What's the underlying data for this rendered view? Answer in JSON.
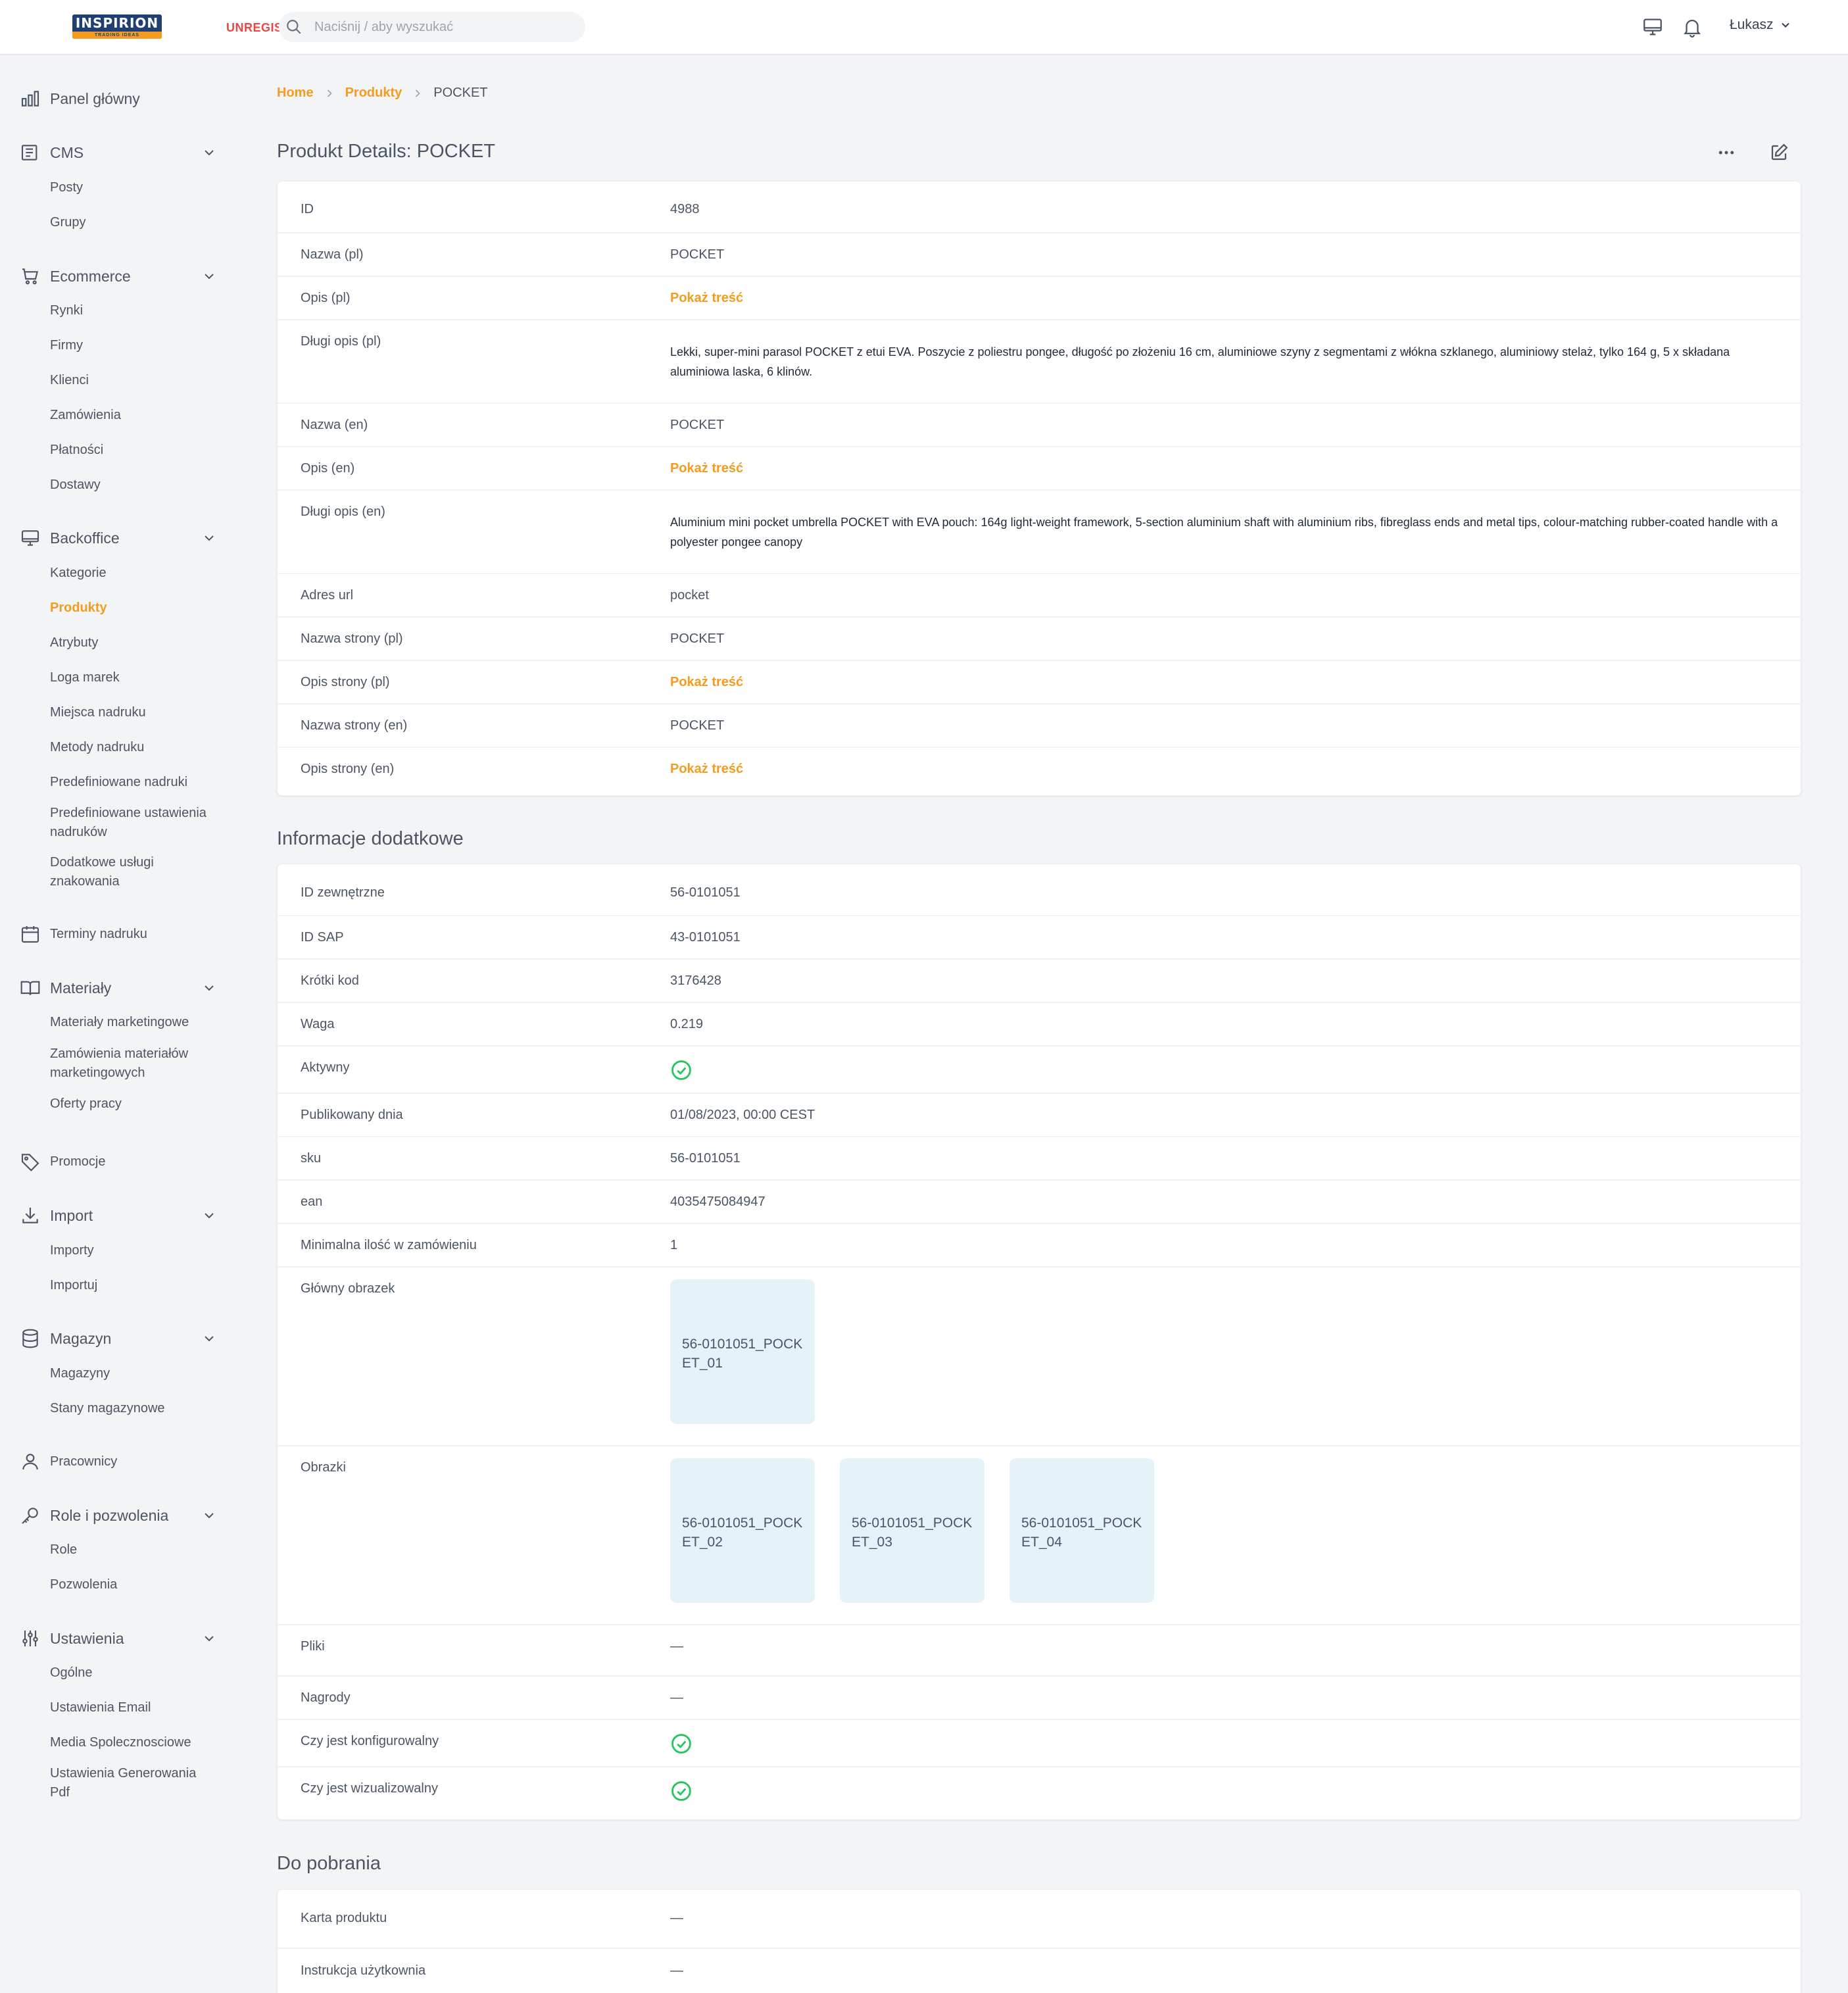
{
  "header": {
    "logo": "INSPIRION",
    "logo_tag": "TRADING IDEAS",
    "unregistered": "UNREGIS",
    "search_placeholder": "Naciśnij / aby wyszukać",
    "user": "Łukasz"
  },
  "sidebar": {
    "groups": [
      {
        "label": "Panel główny",
        "icon": "chart-bar-icon",
        "items": []
      },
      {
        "label": "CMS",
        "icon": "newspaper-icon",
        "items": [
          "Posty",
          "Grupy"
        ]
      },
      {
        "label": "Ecommerce",
        "icon": "cart-icon",
        "items": [
          "Rynki",
          "Firmy",
          "Klienci",
          "Zamówienia",
          "Płatności",
          "Dostawy"
        ]
      },
      {
        "label": "Backoffice",
        "icon": "monitor-icon",
        "items": [
          "Kategorie",
          "Produkty",
          "Atrybuty",
          "Loga marek",
          "Miejsca nadruku",
          "Metody nadruku",
          "Predefiniowane nadruki",
          "Predefiniowane ustawienia nadruków",
          "Dodatkowe usługi znakowania"
        ]
      },
      {
        "label": "Terminy nadruku",
        "icon": "calendar-icon",
        "items": []
      },
      {
        "label": "Materiały",
        "icon": "book-icon",
        "items": [
          "Materiały marketingowe",
          "Zamówienia materiałów marketingowych",
          "Oferty pracy"
        ]
      },
      {
        "label": "Promocje",
        "icon": "tag-icon",
        "items": []
      },
      {
        "label": "Import",
        "icon": "download-icon",
        "items": [
          "Importy",
          "Importuj"
        ]
      },
      {
        "label": "Magazyn",
        "icon": "database-icon",
        "items": [
          "Magazyny",
          "Stany magazynowe"
        ]
      },
      {
        "label": "Pracownicy",
        "icon": "user-icon",
        "items": []
      },
      {
        "label": "Role i pozwolenia",
        "icon": "key-icon",
        "items": [
          "Role",
          "Pozwolenia"
        ]
      },
      {
        "label": "Ustawienia",
        "icon": "sliders-icon",
        "items": [
          "Ogólne",
          "Ustawienia Email",
          "Media Spolecznosciowe",
          "Ustawienia Generowania Pdf"
        ]
      }
    ],
    "active_item": "Produkty"
  },
  "breadcrumb": {
    "home": "Home",
    "section": "Produkty",
    "current": "POCKET"
  },
  "page_title": "Produkt Details: POCKET",
  "details": [
    {
      "label": "ID",
      "value": "4988"
    },
    {
      "label": "Nazwa (pl)",
      "value": "POCKET"
    },
    {
      "label": "Opis (pl)",
      "value": "Pokaż treść"
    },
    {
      "label": "Długi opis (pl)",
      "value": "Lekki, super-mini parasol POCKET z etui EVA. Poszycie z poliestru pongee, długość po złożeniu 16 cm, aluminiowe szyny z segmentami z włókna szklanego, aluminiowy stelaż, tylko 164 g, 5 x składana aluminiowa laska, 6 klinów."
    },
    {
      "label": "Nazwa (en)",
      "value": "POCKET"
    },
    {
      "label": "Opis (en)",
      "value": "Pokaż treść"
    },
    {
      "label": "Długi opis (en)",
      "value": "Aluminium mini pocket umbrella POCKET with EVA pouch: 164g light-weight framework, 5-section aluminium shaft with aluminium ribs, fibreglass ends and metal tips, colour-matching rubber-coated handle with a polyester pongee canopy"
    },
    {
      "label": "Adres url",
      "value": "pocket"
    },
    {
      "label": "Nazwa strony (pl)",
      "value": "POCKET"
    },
    {
      "label": "Opis strony (pl)",
      "value": "Pokaż treść"
    },
    {
      "label": "Nazwa strony (en)",
      "value": "POCKET"
    },
    {
      "label": "Opis strony (en)",
      "value": "Pokaż treść"
    }
  ],
  "additional_title": "Informacje dodatkowe",
  "additional": {
    "external_id": {
      "label": "ID zewnętrzne",
      "value": "56-0101051"
    },
    "sap_id": {
      "label": "ID SAP",
      "value": "43-0101051"
    },
    "short_code": {
      "label": "Krótki kod",
      "value": "3176428"
    },
    "weight": {
      "label": "Waga",
      "value": "0.219"
    },
    "active": {
      "label": "Aktywny",
      "value": true
    },
    "published": {
      "label": "Publikowany dnia",
      "value": "01/08/2023, 00:00 CEST"
    },
    "sku": {
      "label": "sku",
      "value": "56-0101051"
    },
    "ean": {
      "label": "ean",
      "value": "4035475084947"
    },
    "min_qty": {
      "label": "Minimalna ilość w zamówieniu",
      "value": "1"
    },
    "main_image": {
      "label": "Główny obrazek",
      "value": "56-0101051_POCKET_01"
    },
    "images": {
      "label": "Obrazki",
      "values": [
        "56-0101051_POCKET_02",
        "56-0101051_POCKET_03",
        "56-0101051_POCKET_04"
      ]
    },
    "files": {
      "label": "Pliki",
      "value": "—"
    },
    "awards": {
      "label": "Nagrody",
      "value": "—"
    },
    "configurable": {
      "label": "Czy jest konfigurowalny",
      "value": true
    },
    "visualizable": {
      "label": "Czy jest wizualizowalny",
      "value": true
    }
  },
  "downloads_title": "Do pobrania",
  "downloads": [
    {
      "label": "Karta produktu",
      "value": "—"
    },
    {
      "label": "Instrukcja użytkownia",
      "value": "—"
    }
  ],
  "colors": {
    "accent": "#f39c1f",
    "success": "#22c55e",
    "thumb_bg": "#e6f2fa"
  }
}
